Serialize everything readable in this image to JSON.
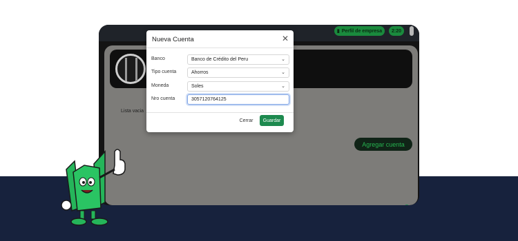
{
  "topbar": {
    "profile_label": "Perfil de empresa",
    "time": "2:20"
  },
  "main": {
    "empty_label": "Lista vacia",
    "add_button": "Agregar cuenta"
  },
  "modal": {
    "title": "Nueva Cuenta",
    "close_icon": "close-icon",
    "fields": [
      {
        "label": "Banco",
        "value": "Banco de Crédito del Peru",
        "type": "select"
      },
      {
        "label": "Tipo cuenta",
        "value": "Ahorros",
        "type": "select"
      },
      {
        "label": "Moneda",
        "value": "Soles",
        "type": "select"
      },
      {
        "label": "Nro cuenta",
        "value": "3057120764125",
        "type": "text"
      }
    ],
    "cancel_button": "Cerrar",
    "save_button": "Guardar"
  },
  "colors": {
    "accent_green": "#1d8a4f",
    "navy": "#17223d",
    "mascot_green": "#25b55a"
  }
}
